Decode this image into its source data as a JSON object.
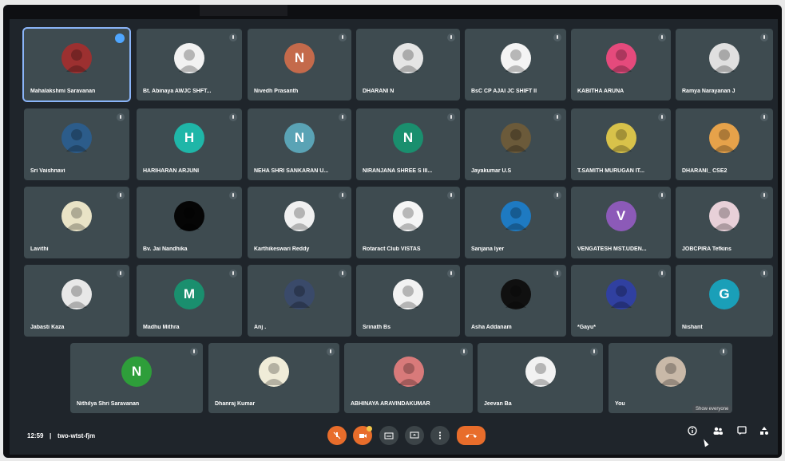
{
  "meeting": {
    "time": "12:59",
    "separator": "|",
    "code": "two-wtst-fjm"
  },
  "tooltip": {
    "text": "Show everyone"
  },
  "participants": [
    {
      "name": "Mahalakshmi Saravanan",
      "avatar": {
        "type": "photo",
        "color": "#9c3030"
      }
    },
    {
      "name": "Bt. Abinaya AWJC SHFT...",
      "avatar": {
        "type": "photo",
        "color": "#f2f2f2"
      }
    },
    {
      "name": "Nivedh Prasanth",
      "avatar": {
        "type": "letter",
        "letter": "N",
        "color": "#c46a4b"
      }
    },
    {
      "name": "DHARANI N",
      "avatar": {
        "type": "photo",
        "color": "#e5e5e5"
      }
    },
    {
      "name": "BsC CP AJAI JC SHIFT II",
      "avatar": {
        "type": "photo",
        "color": "#f4f4f4"
      }
    },
    {
      "name": "KABITHA ARUNA",
      "avatar": {
        "type": "photo",
        "color": "#e54a7c"
      }
    },
    {
      "name": "Ramya Narayanan J",
      "avatar": {
        "type": "photo",
        "color": "#e0e0e0"
      }
    },
    {
      "name": "Sri Vaishnavi",
      "avatar": {
        "type": "photo",
        "color": "#2c5c8a"
      }
    },
    {
      "name": "HARIHARAN ARJUNI",
      "avatar": {
        "type": "letter",
        "letter": "H",
        "color": "#1fb6a8"
      }
    },
    {
      "name": "NEHA SHRI SANKARAN U...",
      "avatar": {
        "type": "letter",
        "letter": "N",
        "color": "#5aa3b5"
      }
    },
    {
      "name": "NIRANJANA SHREE S III...",
      "avatar": {
        "type": "letter",
        "letter": "N",
        "color": "#1a8f6e"
      }
    },
    {
      "name": "Jayakumar U.S",
      "avatar": {
        "type": "photo",
        "color": "#6b5a3a"
      }
    },
    {
      "name": "T.SAMITH MURUGAN IT...",
      "avatar": {
        "type": "photo",
        "color": "#d8c24a"
      }
    },
    {
      "name": "DHARANI_ CSE2",
      "avatar": {
        "type": "photo",
        "color": "#e6a24a"
      }
    },
    {
      "name": "Lavithi",
      "avatar": {
        "type": "photo",
        "color": "#e9e3c6"
      }
    },
    {
      "name": "Bv. Jai Nandhika",
      "avatar": {
        "type": "photo",
        "color": "#050505"
      }
    },
    {
      "name": "Karthikeswari Reddy",
      "avatar": {
        "type": "photo",
        "color": "#f0f0f0"
      }
    },
    {
      "name": "Rotaract Club VISTAS",
      "avatar": {
        "type": "photo",
        "color": "#f5f5f5"
      }
    },
    {
      "name": "Sanjana Iyer",
      "avatar": {
        "type": "photo",
        "color": "#1e7ac2"
      }
    },
    {
      "name": "VENGATESH MST.UDEN...",
      "avatar": {
        "type": "letter",
        "letter": "V",
        "color": "#8c5ab8"
      }
    },
    {
      "name": "JOBCPIRA Tefkins",
      "avatar": {
        "type": "photo",
        "color": "#e8d0d8"
      }
    },
    {
      "name": "Jabasti Kaza",
      "avatar": {
        "type": "photo",
        "color": "#e8e8e8"
      }
    },
    {
      "name": "Madhu Mithra",
      "avatar": {
        "type": "letter",
        "letter": "M",
        "color": "#1a8f6e"
      }
    },
    {
      "name": "Anj .",
      "avatar": {
        "type": "photo",
        "color": "#3a4a6a"
      }
    },
    {
      "name": "Srinath Bs",
      "avatar": {
        "type": "photo",
        "color": "#f2f2f2"
      }
    },
    {
      "name": "Asha Addanam",
      "avatar": {
        "type": "photo",
        "color": "#101010"
      }
    },
    {
      "name": "*Gayu*",
      "avatar": {
        "type": "photo",
        "color": "#3040a0"
      }
    },
    {
      "name": "Nishant",
      "avatar": {
        "type": "letter",
        "letter": "G",
        "color": "#1a9fb8"
      }
    },
    {
      "name": "Nithilya Shri Saravanan",
      "avatar": {
        "type": "letter",
        "letter": "N",
        "color": "#2e9e3a"
      }
    },
    {
      "name": "Dhanraj Kumar",
      "avatar": {
        "type": "photo",
        "color": "#f0ecd8"
      }
    },
    {
      "name": "ABHINAYA ARAVINDAKUMAR",
      "avatar": {
        "type": "photo",
        "color": "#d87a7a"
      }
    },
    {
      "name": "Jeevan Ba",
      "avatar": {
        "type": "photo",
        "color": "#f2f2f2"
      }
    },
    {
      "name": "You",
      "avatar": {
        "type": "photo",
        "color": "#c9b9a8"
      }
    }
  ]
}
